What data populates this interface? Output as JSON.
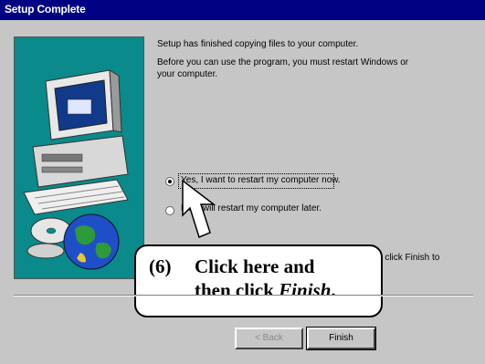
{
  "window": {
    "title": "Setup Complete"
  },
  "message": {
    "line1": "Setup has finished copying files to your computer.",
    "line2a": "Before you can use the program, you must restart Windows or",
    "line2b": "your computer."
  },
  "options": {
    "restart_now": "Yes, I want to restart my computer now.",
    "restart_later": "No, I will restart my computer later.",
    "tail_text": "n click Finish to"
  },
  "buttons": {
    "back": "< Back",
    "finish": "Finish"
  },
  "callout": {
    "step": "(6)",
    "line1": "Click here and",
    "line2_prefix": "then click ",
    "line2_emph": "Finish",
    "line2_suffix": "."
  },
  "colors": {
    "titlebar": "#000082",
    "panel": "#0a8a8a",
    "dialog": "#c6c6c6"
  }
}
